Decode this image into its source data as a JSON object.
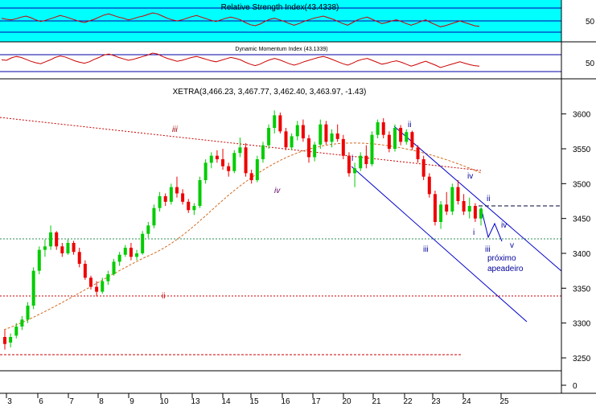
{
  "chart_data": [
    {
      "type": "line",
      "panel": "rsi",
      "title": "Relative Strength Index(43.4338)",
      "y_ticks": [
        50
      ],
      "levels": [
        70,
        50,
        30
      ],
      "shading": "#00ffff",
      "values": [
        58,
        56,
        55,
        57,
        60,
        62,
        59,
        55,
        52,
        54,
        57,
        60,
        63,
        61,
        58,
        55,
        52,
        50,
        53,
        56,
        60,
        64,
        66,
        63,
        60,
        58,
        55,
        57,
        60,
        62,
        65,
        68,
        66,
        62,
        58,
        55,
        53,
        55,
        58,
        61,
        63,
        60,
        57,
        54,
        52,
        55,
        58,
        60,
        58,
        55,
        50,
        46,
        44,
        47,
        52,
        56,
        58,
        55,
        52,
        48,
        45,
        48,
        52,
        55,
        58,
        60,
        62,
        59,
        56,
        52,
        48,
        45,
        50,
        55,
        58,
        60,
        56,
        52,
        48,
        50,
        53,
        55,
        52,
        48,
        45,
        48,
        52,
        55,
        50,
        46,
        42,
        44,
        47,
        50,
        53,
        50,
        47,
        44,
        43
      ]
    },
    {
      "type": "line",
      "panel": "momentum",
      "title": "Dynamic Momentum Index (43.1339)",
      "y_ticks": [
        50
      ],
      "levels": [
        70,
        30
      ],
      "values": [
        56,
        55,
        60,
        63,
        61,
        57,
        53,
        50,
        48,
        52,
        56,
        61,
        64,
        62,
        58,
        54,
        51,
        49,
        52,
        57,
        61,
        66,
        68,
        65,
        61,
        58,
        55,
        57,
        60,
        63,
        66,
        70,
        68,
        63,
        59,
        56,
        53,
        55,
        58,
        61,
        63,
        60,
        57,
        54,
        52,
        55,
        58,
        61,
        59,
        56,
        51,
        47,
        44,
        47,
        52,
        56,
        59,
        56,
        52,
        48,
        45,
        48,
        52,
        55,
        58,
        61,
        63,
        60,
        56,
        52,
        48,
        45,
        49,
        54,
        57,
        59,
        55,
        51,
        47,
        49,
        52,
        54,
        51,
        47,
        43,
        46,
        50,
        53,
        49,
        45,
        40,
        43,
        46,
        49,
        52,
        49,
        46,
        44,
        43
      ]
    },
    {
      "type": "candlestick",
      "panel": "price",
      "title": "XETRA(3,466.23, 3,467.77, 3,462.40, 3,463.97, -1.43)",
      "x_ticks": [
        "3",
        "6",
        "7",
        "8",
        "9",
        "10",
        "13",
        "14",
        "15",
        "16",
        "17",
        "20",
        "21",
        "22",
        "23",
        "24",
        "25"
      ],
      "y_ticks": [
        3600,
        3550,
        3500,
        3450,
        3400,
        3350,
        3300,
        3250,
        0
      ],
      "ylim": [
        3235,
        3625
      ],
      "candles": [
        [
          3280,
          3290,
          3262,
          3270
        ],
        [
          3272,
          3285,
          3265,
          3280
        ],
        [
          3282,
          3300,
          3278,
          3295
        ],
        [
          3295,
          3310,
          3290,
          3305
        ],
        [
          3305,
          3330,
          3300,
          3325
        ],
        [
          3325,
          3380,
          3320,
          3375
        ],
        [
          3375,
          3410,
          3370,
          3405
        ],
        [
          3405,
          3420,
          3395,
          3410
        ],
        [
          3410,
          3440,
          3405,
          3430
        ],
        [
          3430,
          3432,
          3405,
          3410
        ],
        [
          3410,
          3415,
          3395,
          3400
        ],
        [
          3400,
          3420,
          3398,
          3415
        ],
        [
          3415,
          3418,
          3398,
          3402
        ],
        [
          3402,
          3408,
          3380,
          3385
        ],
        [
          3385,
          3390,
          3362,
          3365
        ],
        [
          3365,
          3368,
          3348,
          3352
        ],
        [
          3352,
          3360,
          3338,
          3345
        ],
        [
          3345,
          3365,
          3342,
          3360
        ],
        [
          3360,
          3375,
          3355,
          3370
        ],
        [
          3370,
          3392,
          3368,
          3388
        ],
        [
          3388,
          3402,
          3382,
          3398
        ],
        [
          3398,
          3412,
          3395,
          3408
        ],
        [
          3408,
          3415,
          3390,
          3395
        ],
        [
          3395,
          3405,
          3390,
          3400
        ],
        [
          3400,
          3432,
          3398,
          3428
        ],
        [
          3428,
          3445,
          3422,
          3440
        ],
        [
          3440,
          3470,
          3436,
          3465
        ],
        [
          3465,
          3488,
          3460,
          3482
        ],
        [
          3482,
          3486,
          3468,
          3474
        ],
        [
          3474,
          3500,
          3470,
          3495
        ],
        [
          3495,
          3510,
          3480,
          3486
        ],
        [
          3486,
          3492,
          3470,
          3474
        ],
        [
          3474,
          3478,
          3458,
          3462
        ],
        [
          3462,
          3472,
          3455,
          3468
        ],
        [
          3468,
          3510,
          3465,
          3505
        ],
        [
          3505,
          3535,
          3500,
          3530
        ],
        [
          3530,
          3545,
          3522,
          3540
        ],
        [
          3540,
          3548,
          3530,
          3535
        ],
        [
          3535,
          3550,
          3520,
          3525
        ],
        [
          3525,
          3530,
          3510,
          3518
        ],
        [
          3518,
          3548,
          3515,
          3544
        ],
        [
          3544,
          3566,
          3538,
          3552
        ],
        [
          3552,
          3558,
          3510,
          3515
        ],
        [
          3515,
          3520,
          3500,
          3505
        ],
        [
          3505,
          3540,
          3502,
          3535
        ],
        [
          3535,
          3560,
          3530,
          3555
        ],
        [
          3555,
          3585,
          3550,
          3580
        ],
        [
          3580,
          3605,
          3572,
          3598
        ],
        [
          3598,
          3602,
          3572,
          3575
        ],
        [
          3575,
          3580,
          3548,
          3552
        ],
        [
          3552,
          3572,
          3548,
          3568
        ],
        [
          3568,
          3590,
          3562,
          3584
        ],
        [
          3584,
          3592,
          3560,
          3565
        ],
        [
          3565,
          3570,
          3530,
          3538
        ],
        [
          3538,
          3560,
          3532,
          3556
        ],
        [
          3556,
          3592,
          3550,
          3585
        ],
        [
          3585,
          3590,
          3556,
          3560
        ],
        [
          3560,
          3578,
          3552,
          3572
        ],
        [
          3572,
          3585,
          3560,
          3564
        ],
        [
          3564,
          3570,
          3535,
          3540
        ],
        [
          3540,
          3545,
          3510,
          3515
        ],
        [
          3515,
          3530,
          3495,
          3522
        ],
        [
          3522,
          3545,
          3518,
          3540
        ],
        [
          3540,
          3555,
          3522,
          3528
        ],
        [
          3528,
          3575,
          3525,
          3570
        ],
        [
          3570,
          3592,
          3565,
          3588
        ],
        [
          3588,
          3594,
          3565,
          3570
        ],
        [
          3570,
          3575,
          3545,
          3550
        ],
        [
          3550,
          3585,
          3546,
          3580
        ],
        [
          3580,
          3584,
          3555,
          3560
        ],
        [
          3560,
          3578,
          3556,
          3574
        ],
        [
          3574,
          3576,
          3548,
          3552
        ],
        [
          3552,
          3555,
          3530,
          3535
        ],
        [
          3535,
          3540,
          3505,
          3510
        ],
        [
          3510,
          3515,
          3480,
          3485
        ],
        [
          3485,
          3490,
          3440,
          3445
        ],
        [
          3445,
          3475,
          3435,
          3470
        ],
        [
          3470,
          3488,
          3455,
          3460
        ],
        [
          3460,
          3500,
          3455,
          3495
        ],
        [
          3495,
          3505,
          3470,
          3475
        ],
        [
          3475,
          3485,
          3455,
          3460
        ],
        [
          3460,
          3480,
          3450,
          3468
        ],
        [
          3468,
          3472,
          3445,
          3450
        ],
        [
          3450,
          3466,
          3440,
          3464
        ]
      ],
      "annotations": [
        {
          "text": "iii",
          "color": "#990000"
        },
        {
          "text": "iv",
          "color": "#660066"
        },
        {
          "text": "ii",
          "color": "#cc0000"
        },
        {
          "text": "i",
          "color": "#000099"
        },
        {
          "text": "ii",
          "color": "#000099"
        },
        {
          "text": "iii",
          "color": "#000099"
        },
        {
          "text": "iv",
          "color": "#000099"
        },
        {
          "text": "ii",
          "color": "#000099"
        },
        {
          "text": "iv",
          "color": "#000099"
        },
        {
          "text": "i",
          "color": "#000099"
        },
        {
          "text": "iii",
          "color": "#000099"
        },
        {
          "text": "v",
          "color": "#000099"
        },
        {
          "text": "próximo",
          "color": "#000099"
        },
        {
          "text": "apeadeiro",
          "color": "#000099"
        }
      ]
    }
  ]
}
